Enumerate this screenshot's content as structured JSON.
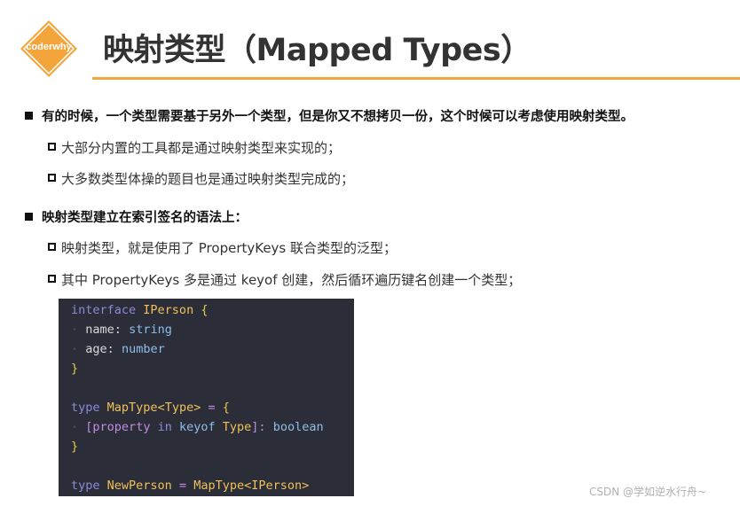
{
  "header": {
    "logo_text": "coderwhy",
    "title": "映射类型（Mapped Types）"
  },
  "bullets": [
    {
      "level": 1,
      "text": "有的时候，一个类型需要基于另外一个类型，但是你又不想拷贝一份，这个时候可以考虑使用映射类型。"
    },
    {
      "level": 2,
      "text": "大部分内置的工具都是通过映射类型来实现的；"
    },
    {
      "level": 2,
      "text": "大多数类型体操的题目也是通过映射类型完成的；"
    },
    {
      "level": 1,
      "text": "映射类型建立在索引签名的语法上："
    },
    {
      "level": 2,
      "text": "映射类型，就是使用了 PropertyKeys 联合类型的泛型；"
    },
    {
      "level": 2,
      "text": "其中 PropertyKeys 多是通过 keyof 创建，然后循环遍历键名创建一个类型；"
    }
  ],
  "code": {
    "l1": {
      "kw": "interface",
      "name": "IPerson",
      "brace": "{"
    },
    "l2": {
      "prop": "name",
      "colon": ":",
      "type": "string"
    },
    "l3": {
      "prop": "age",
      "colon": ":",
      "type": "number"
    },
    "l4": {
      "brace": "}"
    },
    "l6": {
      "kw": "type",
      "name": "MapType",
      "generic": "<Type>",
      "eq": "=",
      "brace": "{"
    },
    "l7": {
      "open": "[",
      "prop": "property",
      "in": "in",
      "keyof": "keyof",
      "type": "Type",
      "close": "]:",
      "value": "boolean"
    },
    "l8": {
      "brace": "}"
    },
    "l10": {
      "kw": "type",
      "name": "NewPerson",
      "eq": "=",
      "value": "MapType<IPerson>"
    }
  },
  "watermark": "CSDN @学如逆水行舟~"
}
